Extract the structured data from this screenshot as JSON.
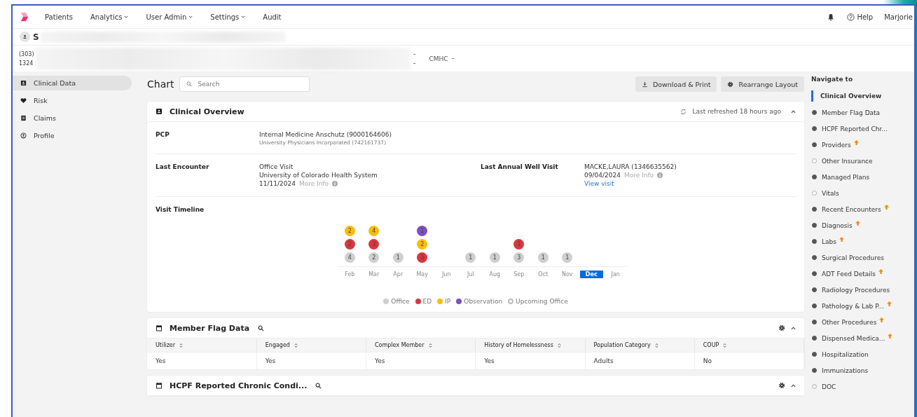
{
  "top_nav": {
    "menus": [
      {
        "label": "Patients",
        "dropdown": false
      },
      {
        "label": "Analytics",
        "dropdown": true
      },
      {
        "label": "User Admin",
        "dropdown": true
      },
      {
        "label": "Settings",
        "dropdown": true
      },
      {
        "label": "Audit",
        "dropdown": false
      }
    ],
    "help": "Help",
    "user": "Marjorie"
  },
  "patient": {
    "initial": "S",
    "phone": "(303)",
    "address": "1324",
    "dash_1": "–",
    "program": "CMHC",
    "dash_2": "–",
    "dash_3": "–"
  },
  "sidebar": {
    "items": [
      {
        "label": "Clinical Data",
        "kind": "clinical",
        "selected": true
      },
      {
        "label": "Risk",
        "kind": "risk",
        "selected": false
      },
      {
        "label": "Claims",
        "kind": "claims",
        "selected": false
      },
      {
        "label": "Profile",
        "kind": "profile",
        "selected": false
      }
    ]
  },
  "toolbar": {
    "title": "Chart",
    "search": {
      "placeholder": "Search"
    },
    "buttons": [
      {
        "label": "Download & Print",
        "kind": "download"
      },
      {
        "label": "Rearrange Layout",
        "kind": "gear"
      }
    ]
  },
  "clinical_overview": {
    "title": "Clinical Overview",
    "refreshed": "Last refreshed 18 hours ago",
    "pcp": {
      "label": "PCP",
      "name": "Internal Medicine Anschutz (9000164606)",
      "org": "University Physicians Incorporated (742161737)"
    },
    "last_encounter": {
      "label": "Last Encounter",
      "type": "Office Visit",
      "facility": "University of Colorado Health System",
      "date": "11/11/2024",
      "more": "More Info"
    },
    "last_well_visit": {
      "label": "Last Annual Well Visit",
      "provider": "MACKE,LAURA (1346635562)",
      "date": "09/04/2024",
      "more": "More Info",
      "link": "View visit"
    },
    "timeline": {
      "label": "Visit Timeline",
      "months": [
        {
          "label": "Feb",
          "selected": false,
          "visits": [
            {
              "count": "2",
              "color": "#fbbd08"
            },
            {
              "count": "2",
              "color": "#d9363e"
            },
            {
              "count": "4",
              "color": "#cfcfcf"
            }
          ]
        },
        {
          "label": "Mar",
          "selected": false,
          "visits": [
            {
              "count": "4",
              "color": "#fbbd08"
            },
            {
              "count": "3",
              "color": "#d9363e"
            },
            {
              "count": "2",
              "color": "#cfcfcf"
            }
          ]
        },
        {
          "label": "Apr",
          "selected": false,
          "visits": [
            {
              "count": "1",
              "color": "#cfcfcf"
            }
          ]
        },
        {
          "label": "May",
          "selected": false,
          "visits": [
            {
              "count": "1",
              "color": "#7e4fc0"
            },
            {
              "count": "2",
              "color": "#fbbd08"
            },
            {
              "count": "3",
              "color": "#d9363e"
            }
          ]
        },
        {
          "label": "Jun",
          "selected": false
        },
        {
          "label": "Jul",
          "selected": false,
          "visits": [
            {
              "count": "1",
              "color": "#cfcfcf"
            }
          ]
        },
        {
          "label": "Aug",
          "selected": false,
          "visits": [
            {
              "count": "1",
              "color": "#cfcfcf"
            }
          ]
        },
        {
          "label": "Sep",
          "selected": false,
          "visits": [
            {
              "count": "1",
              "color": "#d9363e"
            },
            {
              "count": "3",
              "color": "#cfcfcf"
            }
          ]
        },
        {
          "label": "Oct",
          "selected": false,
          "visits": [
            {
              "count": "1",
              "color": "#cfcfcf"
            }
          ]
        },
        {
          "label": "Nov",
          "selected": false,
          "visits": [
            {
              "count": "1",
              "color": "#cfcfcf"
            }
          ]
        },
        {
          "label": "Dec",
          "selected": true
        },
        {
          "label": "Jan",
          "selected": false
        }
      ],
      "legend": [
        {
          "label": "Office",
          "color": "#cfcfcf",
          "hollow": false
        },
        {
          "label": "ED",
          "color": "#d9363e",
          "hollow": false
        },
        {
          "label": "IP",
          "color": "#fbbd08",
          "hollow": false
        },
        {
          "label": "Observation",
          "color": "#7e4fc0",
          "hollow": false
        },
        {
          "label": "Upcoming Office",
          "color": "#bdbdbd",
          "hollow": true
        }
      ]
    }
  },
  "member_flag_data": {
    "title": "Member Flag Data",
    "columns": [
      "Utilizer",
      "Engaged",
      "Complex Member",
      "History of Homelessness",
      "Population Category",
      "COUP"
    ],
    "rows": [
      [
        "Yes",
        "Yes",
        "Yes",
        "Yes",
        "Adults",
        "No"
      ]
    ]
  },
  "chronic_conditions": {
    "title": "HCPF Reported Chronic Condi..."
  },
  "navigate_to": {
    "title": "Navigate to",
    "items": [
      {
        "label": "Clinical Overview",
        "selected": true,
        "flagged": false
      },
      {
        "label": "Member Flag Data",
        "selected": false,
        "empty": false,
        "flagged": false
      },
      {
        "label": "HCPF Reported Chr...",
        "selected": false,
        "empty": false,
        "flagged": false
      },
      {
        "label": "Providers",
        "selected": false,
        "empty": false,
        "flagged": true
      },
      {
        "label": "Other Insurance",
        "selected": false,
        "empty": true,
        "flagged": false
      },
      {
        "label": "Managed Plans",
        "selected": false,
        "empty": false,
        "flagged": false
      },
      {
        "label": "Vitals",
        "selected": false,
        "empty": true,
        "flagged": false
      },
      {
        "label": "Recent Encounters",
        "selected": false,
        "empty": false,
        "flagged": true
      },
      {
        "label": "Diagnosis",
        "selected": false,
        "empty": false,
        "flagged": true
      },
      {
        "label": "Labs",
        "selected": false,
        "empty": false,
        "flagged": true
      },
      {
        "label": "Surgical Procedures",
        "selected": false,
        "empty": false,
        "flagged": false
      },
      {
        "label": "ADT Feed Details",
        "selected": false,
        "empty": false,
        "flagged": true
      },
      {
        "label": "Radiology Procedures",
        "selected": false,
        "empty": false,
        "flagged": false
      },
      {
        "label": "Pathology & Lab P...",
        "selected": false,
        "empty": false,
        "flagged": true
      },
      {
        "label": "Other Procedures",
        "selected": false,
        "empty": false,
        "flagged": true
      },
      {
        "label": "Dispensed Medica...",
        "selected": false,
        "empty": false,
        "flagged": true
      },
      {
        "label": "Hospitalization",
        "selected": false,
        "empty": false,
        "flagged": false
      },
      {
        "label": "Immunizations",
        "selected": false,
        "empty": false,
        "flagged": false
      },
      {
        "label": "DOC",
        "selected": false,
        "empty": true,
        "flagged": false
      }
    ]
  }
}
